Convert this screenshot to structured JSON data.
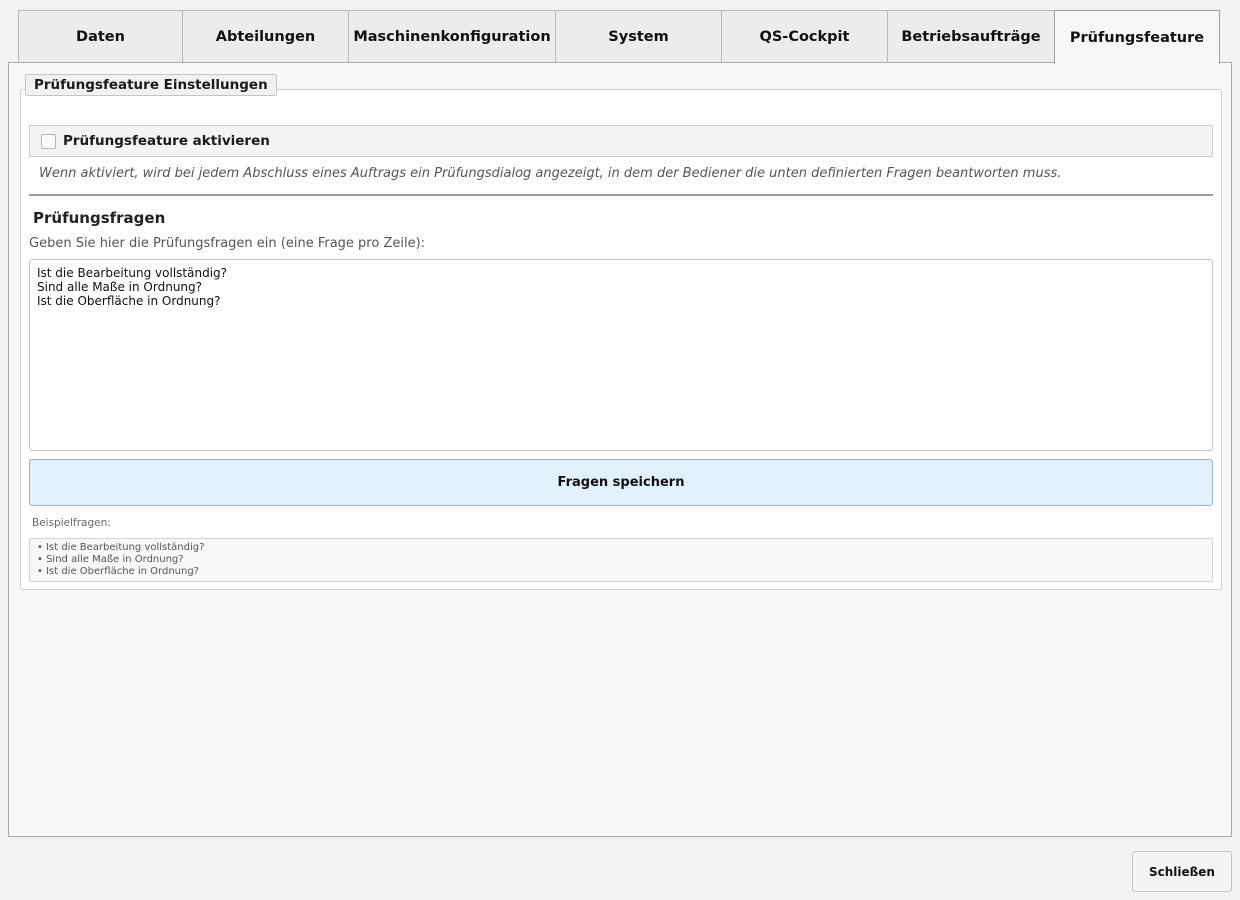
{
  "tabs": [
    {
      "label": "Daten"
    },
    {
      "label": "Abteilungen"
    },
    {
      "label": "Maschinenkonfiguration"
    },
    {
      "label": "System"
    },
    {
      "label": "QS-Cockpit"
    },
    {
      "label": "Betriebsaufträge"
    },
    {
      "label": "Prüfungsfeature",
      "active": true
    }
  ],
  "settings": {
    "group_title": "Prüfungsfeature Einstellungen",
    "enable_label": "Prüfungsfeature aktivieren",
    "enable_checked": false,
    "enable_hint": "Wenn aktiviert, wird bei jedem Abschluss eines Auftrags ein Prüfungsdialog angezeigt, in dem der Bediener die unten definierten Fragen beantworten muss."
  },
  "questions": {
    "section_title": "Prüfungsfragen",
    "input_label": "Geben Sie hier die Prüfungsfragen ein (eine Frage pro Zeile):",
    "value": "Ist die Bearbeitung vollständig?\nSind alle Maße in Ordnung?\nIst die Oberfläche in Ordnung?",
    "save_label": "Fragen speichern",
    "examples_label": "Beispielfragen:",
    "examples": [
      "• Ist die Bearbeitung vollständig?",
      "• Sind alle Maße in Ordnung?",
      "• Ist die Oberfläche in Ordnung?"
    ]
  },
  "footer": {
    "close_label": "Schließen"
  }
}
